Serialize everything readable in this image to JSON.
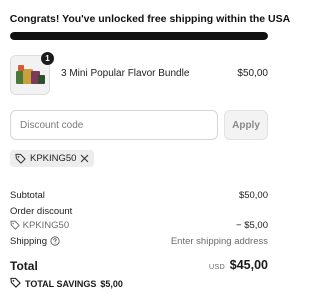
{
  "banner": {
    "message": "Congrats! You've unlocked free shipping within the USA",
    "progress_percent": 100
  },
  "product": {
    "quantity": "1",
    "name": "3 Mini Popular Flavor Bundle",
    "price": "$50,00"
  },
  "discount": {
    "placeholder": "Discount code",
    "apply_label": "Apply",
    "applied_code": "KPKING50"
  },
  "summary": {
    "subtotal_label": "Subtotal",
    "subtotal_value": "$50,00",
    "order_discount_label": "Order discount",
    "order_discount_code": "KPKING50",
    "order_discount_value": "− $5,00",
    "shipping_label": "Shipping",
    "shipping_value": "Enter shipping address"
  },
  "total": {
    "label": "Total",
    "currency": "USD",
    "amount": "$45,00",
    "savings_label": "TOTAL SAVINGS",
    "savings_amount": "$5,00"
  },
  "colors": {
    "progress_fill": "#111111",
    "chip_background": "#ededed"
  },
  "icons": [
    "tag-icon",
    "close-icon",
    "question-circle-icon"
  ]
}
